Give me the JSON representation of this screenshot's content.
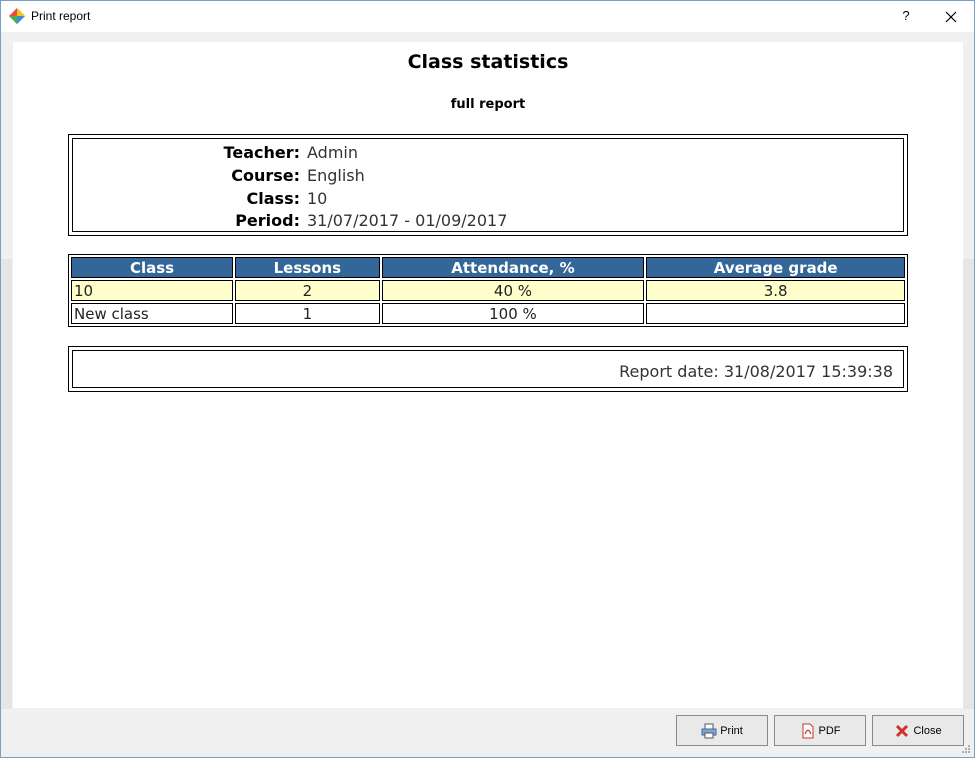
{
  "window": {
    "title": "Print report",
    "help_label": "?"
  },
  "report": {
    "title": "Class statistics",
    "subtitle": "full report",
    "info": [
      {
        "label": "Teacher:",
        "value": "Admin"
      },
      {
        "label": "Course:",
        "value": "English"
      },
      {
        "label": "Class:",
        "value": "10"
      },
      {
        "label": "Period:",
        "value": "31/07/2017 - 01/09/2017"
      }
    ],
    "table": {
      "headers": [
        "Class",
        "Lessons",
        "Attendance, %",
        "Average grade"
      ],
      "rows": [
        [
          "10",
          "2",
          "40 %",
          "3.8"
        ],
        [
          "New class",
          "1",
          "100 %",
          ""
        ]
      ]
    },
    "report_date": "Report date: 31/08/2017 15:39:38"
  },
  "buttons": {
    "print": "Print",
    "pdf": "PDF",
    "close": "Close"
  },
  "colors": {
    "header_bg": "#336699",
    "highlight_row": "#ffffcc"
  }
}
